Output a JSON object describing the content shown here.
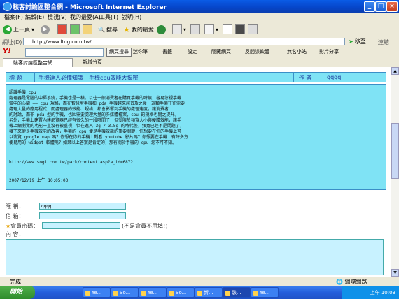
{
  "window": {
    "title": "駭客討論區整合網 - Microsoft Internet Explorer",
    "controls": [
      "_",
      "□",
      "×"
    ]
  },
  "menu": [
    "檔案(F)",
    "編輯(E)",
    "檢視(V)",
    "我的最愛(A)",
    "工具(T)",
    "說明(H)"
  ],
  "toolbar": {
    "back": "上一頁",
    "search": "搜尋",
    "favorites": "我的最愛"
  },
  "address": {
    "label": "網址(D)",
    "value": "http://www.ftng.com.tw/",
    "go": "移至",
    "links": "連結"
  },
  "yahoo": {
    "logo": "Y!",
    "search_button": "網頁搜尋",
    "items": [
      "迷你筆",
      "書籤",
      "設定",
      "隱藏網頁",
      "反間諜軟體",
      "無名小站",
      "影片分享"
    ]
  },
  "tabs": {
    "active": "駭客討論區整合網",
    "new": "新增分頁"
  },
  "post": {
    "header": {
      "label_title": "標 題",
      "title": "手機達人必備知識　手機cpu效能大揭密",
      "label_author": "作 者",
      "author": "qqqq"
    },
    "body": "認識手機 cpu\n處理器是電腦的中樞系統，手機也是一樣。以往一般消費者在購買手機的時候，容易忽視手機\n當中的心臟 —— cpu 規格，而在智慧型手機和 pda 手機越來越普及之後，這類手機往往需要\n處理大量的應用程式，而處理器的效能、規格，都會影響到手機的處理速度，讓消費者\n的討論，而非 pda 型的手機，也因需要處理大量的多媒體檔案，cpu 的規格也開之提升。\n另外，手機上建置內建網覽器已經有很久的一段時間了，但受限於頻寬大小與硬體效能，讓手\n機上網瀏覽的功能一直沒有被重視，但在進入 3g / 3.5g 的時代後，頻寬已經不是問題了，\n接下來便是手機效能的改善，手機的 cpu 便是手機效能的重要關鍵，你想要在你的手機上可\n以瀏覽 google map 嗎？你想在你的手機上觀看 youtube 影片嗎？你想要在手機上有許多方\n便易用的 widget 軟體嗎？如果以上答案是肯定的，那有關於手機的 cpu 您不可不知。",
    "url": "http://www.sogi.com.tw/park/content.asp?a_id=6872",
    "date": "2007/12/19 上午 10:05:03"
  },
  "form": {
    "nickname_label": "暱 稱：",
    "nickname_value": "qqqq",
    "email_label": "信 箱：",
    "email_value": "",
    "password_label": "會員密碼：",
    "password_note": "(不是會員不用填!)",
    "content_label": "內 容："
  },
  "status": {
    "text": "完成",
    "zone": "網際網路"
  },
  "taskbar": {
    "start": "開始",
    "tasks": [
      "Ye...",
      "So...",
      "Ye...",
      "So...",
      "新...",
      "駭...",
      "Ye..."
    ],
    "clock": "上午 10:03"
  }
}
